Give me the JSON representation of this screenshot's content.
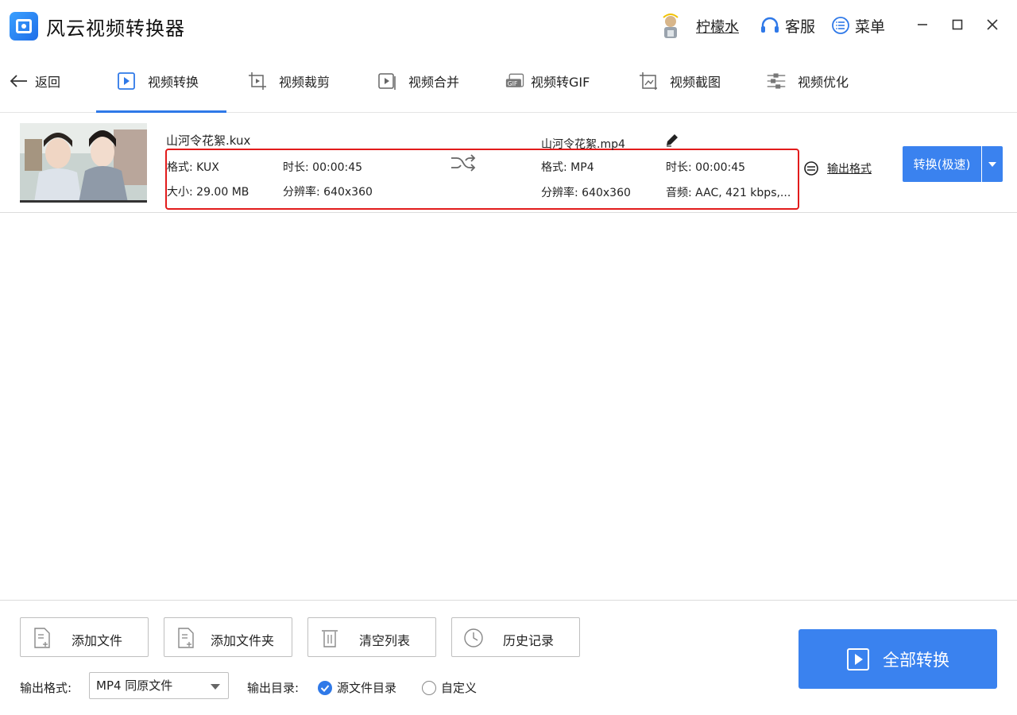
{
  "app": {
    "title": "风云视频转换器"
  },
  "header": {
    "user_name": "柠檬水",
    "service_label": "客服",
    "menu_label": "菜单"
  },
  "nav": {
    "back_label": "返回",
    "tabs": [
      {
        "label": "视频转换",
        "icon": "video-convert-icon",
        "active": true
      },
      {
        "label": "视频裁剪",
        "icon": "video-crop-icon"
      },
      {
        "label": "视频合并",
        "icon": "video-merge-icon"
      },
      {
        "label": "视频转GIF",
        "icon": "gif-icon"
      },
      {
        "label": "视频截图",
        "icon": "screenshot-icon"
      },
      {
        "label": "视频优化",
        "icon": "optimize-icon"
      }
    ]
  },
  "file": {
    "source": {
      "name": "山河令花絮.kux",
      "format": "格式: KUX",
      "duration": "时长: 00:00:45",
      "size": "大小: 29.00 MB",
      "resolution": "分辨率: 640x360"
    },
    "output": {
      "name": "山河令花絮.mp4",
      "format": "格式: MP4",
      "duration": "时长: 00:00:45",
      "resolution": "分辨率: 640x360",
      "audio": "音频: AAC, 421 kbps,..."
    },
    "output_format_label": "输出格式",
    "convert_label": "转换(极速)"
  },
  "bottom": {
    "buttons": [
      {
        "label": "添加文件",
        "icon": "add-file-icon"
      },
      {
        "label": "添加文件夹",
        "icon": "add-folder-icon"
      },
      {
        "label": "清空列表",
        "icon": "trash-icon"
      },
      {
        "label": "历史记录",
        "icon": "clock-icon"
      }
    ],
    "output_format_label": "输出格式:",
    "output_format_value": "MP4 同原文件",
    "output_dir_label": "输出目录:",
    "radio_source": "源文件目录",
    "radio_custom": "自定义",
    "selected_dir": "源文件目录",
    "convert_all_label": "全部转换"
  },
  "colors": {
    "accent": "#3a82ef",
    "highlight_box": "#e21b1b"
  }
}
